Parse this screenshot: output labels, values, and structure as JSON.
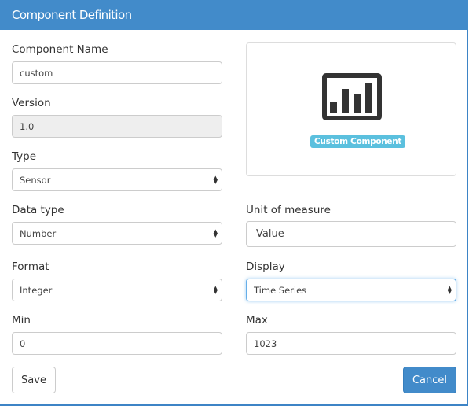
{
  "header": {
    "title": "Component Definition"
  },
  "form": {
    "name": {
      "label": "Component Name",
      "value": "custom"
    },
    "version": {
      "label": "Version",
      "value": "1.0"
    },
    "type": {
      "label": "Type",
      "value": "Sensor"
    },
    "data_type": {
      "label": "Data type",
      "value": "Number"
    },
    "unit": {
      "label": "Unit of measure",
      "value": "Value"
    },
    "format": {
      "label": "Format",
      "value": "Integer"
    },
    "display": {
      "label": "Display",
      "value": "Time Series"
    },
    "min": {
      "label": "Min",
      "value": "0"
    },
    "max": {
      "label": "Max",
      "value": "1023"
    }
  },
  "preview": {
    "icon": "bar-chart-icon",
    "badge": "Custom Component",
    "badge_color": "#5bc0de"
  },
  "buttons": {
    "save": "Save",
    "cancel": "Cancel"
  },
  "colors": {
    "header": "#428bca",
    "primary": "#428bca"
  }
}
